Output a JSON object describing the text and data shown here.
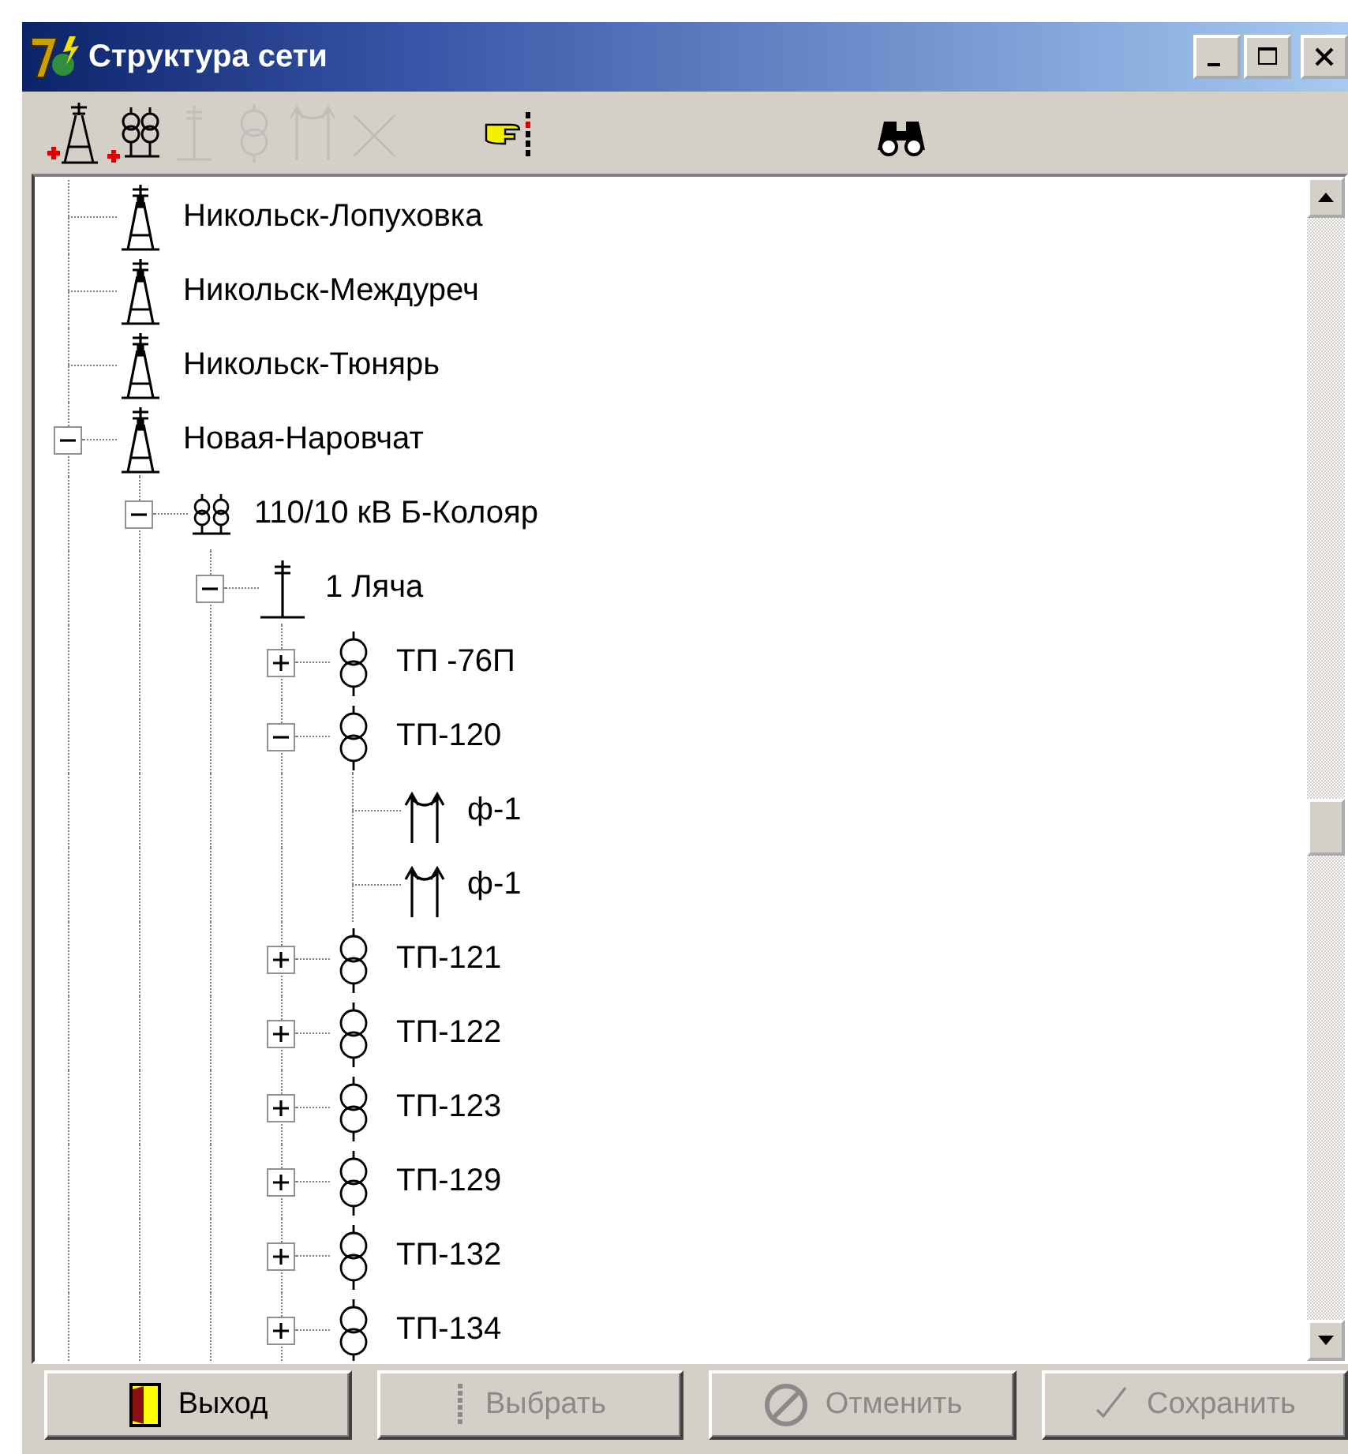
{
  "window": {
    "title": "Структура сети"
  },
  "toolbar": [
    {
      "kind": "add-tower",
      "disabled": false
    },
    {
      "kind": "add-substation",
      "disabled": false
    },
    {
      "kind": "bus",
      "disabled": true
    },
    {
      "kind": "transformer",
      "disabled": true
    },
    {
      "kind": "feeder",
      "disabled": true
    },
    {
      "kind": "delete",
      "disabled": true
    },
    {
      "kind": "pointer",
      "disabled": false
    },
    {
      "kind": "find",
      "disabled": false
    }
  ],
  "tree": [
    {
      "kind": "line",
      "label": "Никольск-Лопуховка"
    },
    {
      "kind": "line",
      "label": "Никольск-Междуреч"
    },
    {
      "kind": "line",
      "label": "Никольск-Тюнярь"
    },
    {
      "kind": "line",
      "label": "Новая-Наровчат",
      "expanded": true,
      "children": [
        {
          "kind": "substation",
          "label": "110/10 кВ Б-Колояр",
          "expanded": true,
          "children": [
            {
              "kind": "bus",
              "label": "1 Ляча",
              "expanded": true,
              "children": [
                {
                  "kind": "tp",
                  "label": "ТП -76П",
                  "expanded": false
                },
                {
                  "kind": "tp",
                  "label": "ТП-120",
                  "expanded": true,
                  "children": [
                    {
                      "kind": "feeder",
                      "label": "ф-1"
                    },
                    {
                      "kind": "feeder",
                      "label": "ф-1"
                    }
                  ]
                },
                {
                  "kind": "tp",
                  "label": "ТП-121",
                  "expanded": false
                },
                {
                  "kind": "tp",
                  "label": "ТП-122",
                  "expanded": false
                },
                {
                  "kind": "tp",
                  "label": "ТП-123",
                  "expanded": false
                },
                {
                  "kind": "tp",
                  "label": "ТП-129",
                  "expanded": false
                },
                {
                  "kind": "tp",
                  "label": "ТП-132",
                  "expanded": false
                },
                {
                  "kind": "tp",
                  "label": "ТП-134",
                  "expanded": false
                }
              ]
            }
          ]
        }
      ]
    }
  ],
  "buttons": [
    {
      "kind": "exit",
      "label": "Выход",
      "disabled": false
    },
    {
      "kind": "select",
      "label": "Выбрать",
      "disabled": true
    },
    {
      "kind": "cancel",
      "label": "Отменить",
      "disabled": true
    },
    {
      "kind": "save",
      "label": "Сохранить",
      "disabled": true
    }
  ]
}
